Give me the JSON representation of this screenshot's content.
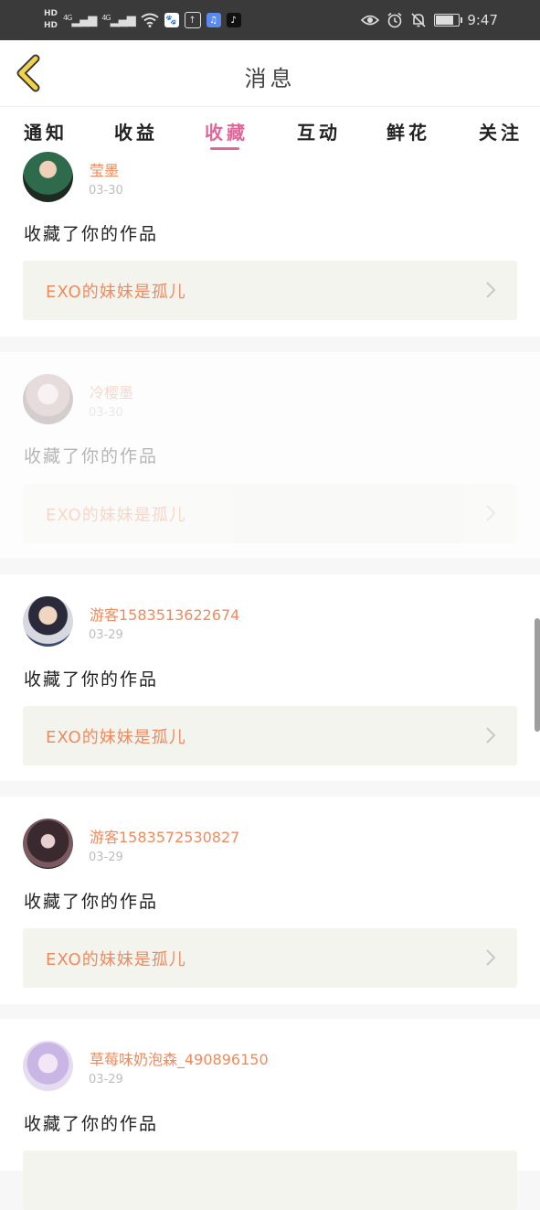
{
  "status_bar": {
    "hd1": "HD",
    "hd2": "HD",
    "signal1": "4G",
    "signal2": "4G",
    "time": "9:47",
    "battery_level": 0.85,
    "icons": [
      "wifi-icon",
      "baidu-app-icon",
      "upload-app-icon",
      "music-app-icon",
      "tiktok-app-icon",
      "eye-icon",
      "alarm-icon",
      "mute-icon",
      "battery-icon"
    ]
  },
  "header": {
    "title": "消息",
    "back_icon": "chevron-left-icon",
    "accent": "#f2d44a"
  },
  "tabs": [
    {
      "label": "通知",
      "active": false
    },
    {
      "label": "收益",
      "active": false
    },
    {
      "label": "收藏",
      "active": true
    },
    {
      "label": "互动",
      "active": false
    },
    {
      "label": "鲜花",
      "active": false
    },
    {
      "label": "关注",
      "active": false
    }
  ],
  "colors": {
    "accent": "#e0679a",
    "username": "#f08a5d",
    "work_bg": "#f4f4ee"
  },
  "messages": [
    {
      "username": "莹墨",
      "date": "03-30",
      "action": "收藏了你的作品",
      "work_title": "EXO的妹妹是孤儿"
    },
    {
      "username": "冷樱墨",
      "date": "03-30",
      "action": "收藏了你的作品",
      "work_title": "EXO的妹妹是孤儿",
      "faded": true
    },
    {
      "username": "游客1583513622674",
      "date": "03-29",
      "action": "收藏了你的作品",
      "work_title": "EXO的妹妹是孤儿"
    },
    {
      "username": "游客1583572530827",
      "date": "03-29",
      "action": "收藏了你的作品",
      "work_title": "EXO的妹妹是孤儿"
    },
    {
      "username": "草莓味奶泡森_490896150",
      "date": "03-29",
      "action": "收藏了你的作品",
      "work_title": ""
    }
  ]
}
